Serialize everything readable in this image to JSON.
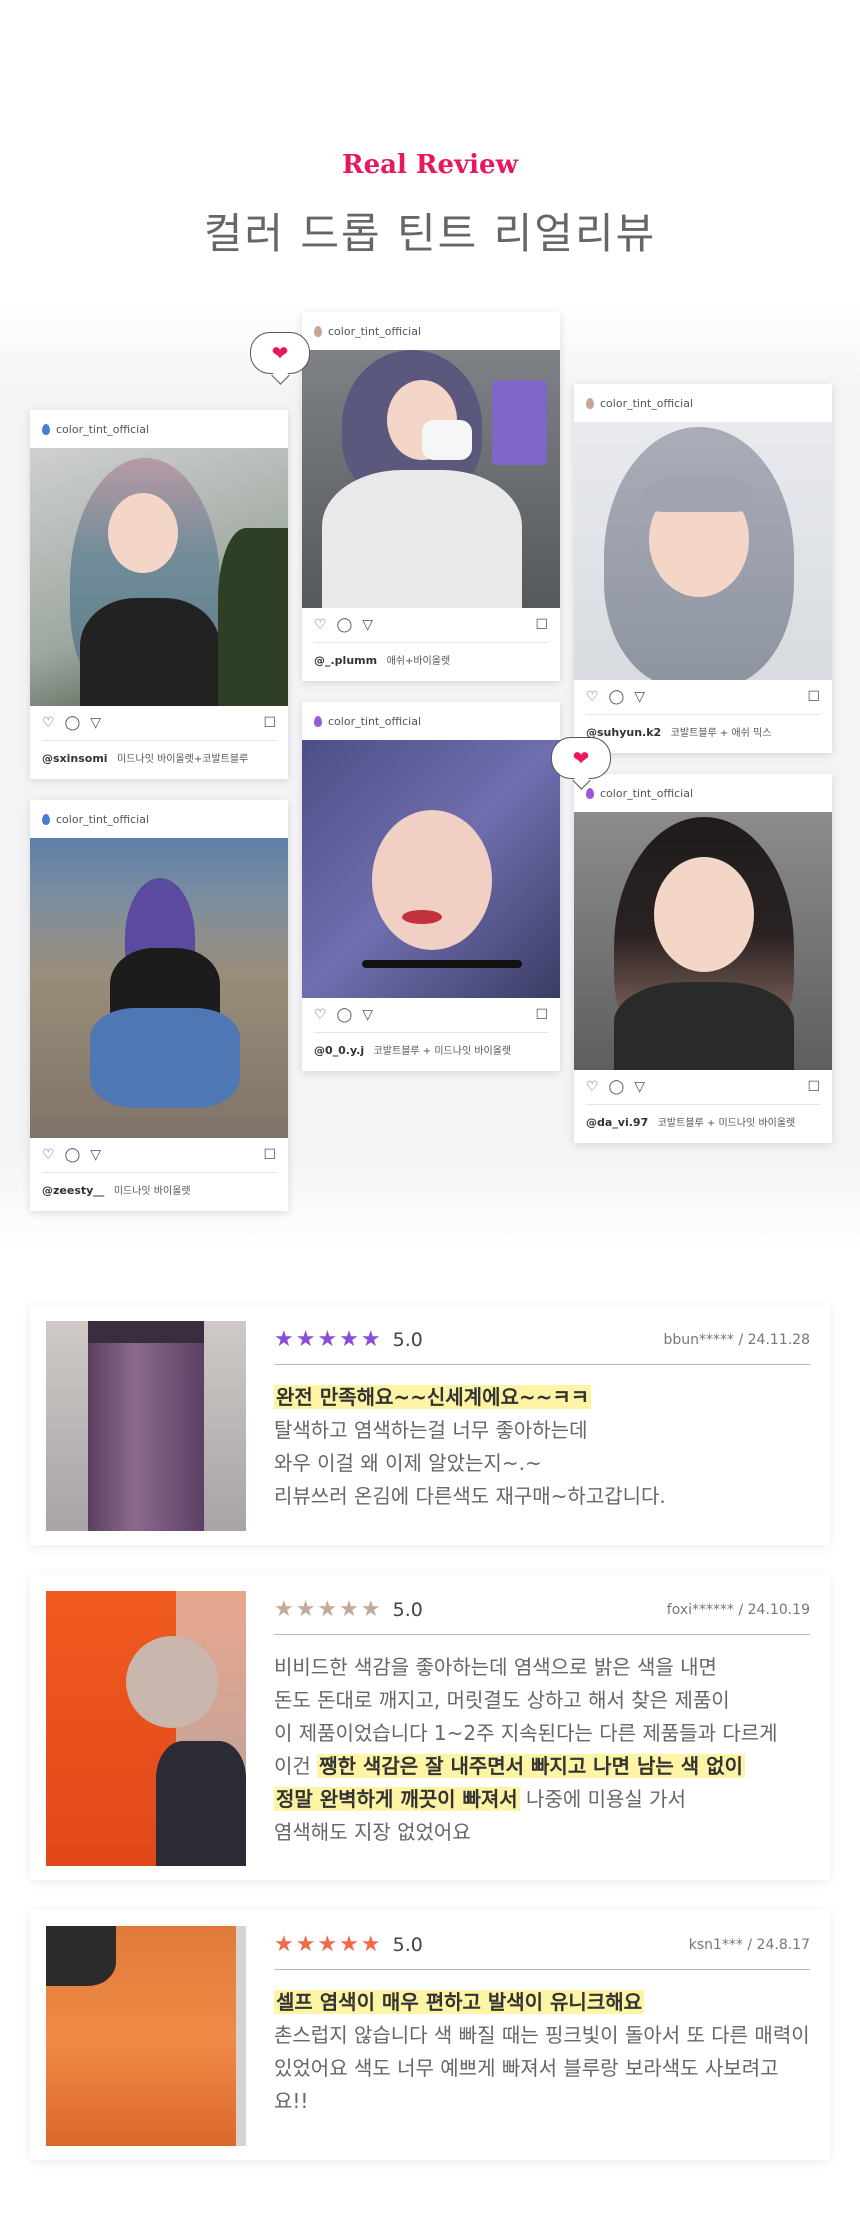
{
  "header": {
    "eyebrow": "Real Review",
    "title": "컬러 드롭 틴트 리얼리뷰"
  },
  "posts": [
    {
      "account": "color_tint_official",
      "user": "@sxinsomi",
      "tags": "미드나잇 바이올렛+코발트블루",
      "accent": "#4a7bd8"
    },
    {
      "account": "color_tint_official",
      "user": "@_.plumm",
      "tags": "애쉬+바이올렛",
      "accent": "#c9a58f"
    },
    {
      "account": "color_tint_official",
      "user": "@suhyun.k2",
      "tags": "코발트블루 + 애쉬 믹스",
      "accent": "#c9a58f"
    },
    {
      "account": "color_tint_official",
      "user": "@zeesty__",
      "tags": "미드나잇 바이올렛",
      "accent": "#4a7bd8"
    },
    {
      "account": "color_tint_official",
      "user": "@0_0.y.j",
      "tags": "코발트블루 + 미드나잇 바이올렛",
      "accent": "#9b59d6"
    },
    {
      "account": "color_tint_official",
      "user": "@da_vi.97",
      "tags": "코발트블루 + 미드나잇 바이올렛",
      "accent": "#9b59d6"
    }
  ],
  "icons": {
    "heart": "♡",
    "comment": "◯",
    "share": "▽",
    "bookmark": "☐",
    "bubble_heart": "❤"
  },
  "reviews": [
    {
      "stars": "★★★★★",
      "star_color": "#8a4fd6",
      "score": "5.0",
      "meta": "bbun***** / 24.11.28",
      "highlight": "완전 만족해요~~신세계에요~~ㅋㅋ",
      "lines": [
        "탈색하고 염색하는걸 너무 좋아하는데",
        "와우 이걸 왜 이제 알았는지~.~",
        "리뷰쓰러 온김에 다른색도 재구매~하고갑니다."
      ]
    },
    {
      "stars": "★★★★★",
      "star_color": "#c2a999",
      "score": "5.0",
      "meta": "foxi****** / 24.10.19",
      "line1": "비비드한 색감을 좋아하는데 염색으로 밝은 색을 내면",
      "line2": "돈도 돈대로 깨지고, 머릿결도 상하고 해서 찾은 제품이",
      "line3": "이 제품이었습니다 1~2주 지속된다는 다른 제품들과 다르게",
      "line4_pre": "이건 ",
      "line4_hl": "쨍한 색감은 잘 내주면서 빠지고 나면 남는 색 없이",
      "line5_hl": "정말 완벽하게 깨끗이 빠져서",
      "line5_post": " 나중에 미용실 가서",
      "line6": "염색해도 지장 없었어요"
    },
    {
      "stars": "★★★★★",
      "star_color": "#ef6b4a",
      "score": "5.0",
      "meta": "ksn1*** / 24.8.17",
      "highlight": "셀프 염색이 매우 편하고 발색이 유니크해요",
      "lines": [
        "촌스럽지 않습니다 색 빠질 때는 핑크빛이 돌아서 또 다른 매력이",
        "있었어요 색도 너무 예쁘게 빠져서 블루랑 보라색도 사보려고요!!"
      ]
    }
  ]
}
